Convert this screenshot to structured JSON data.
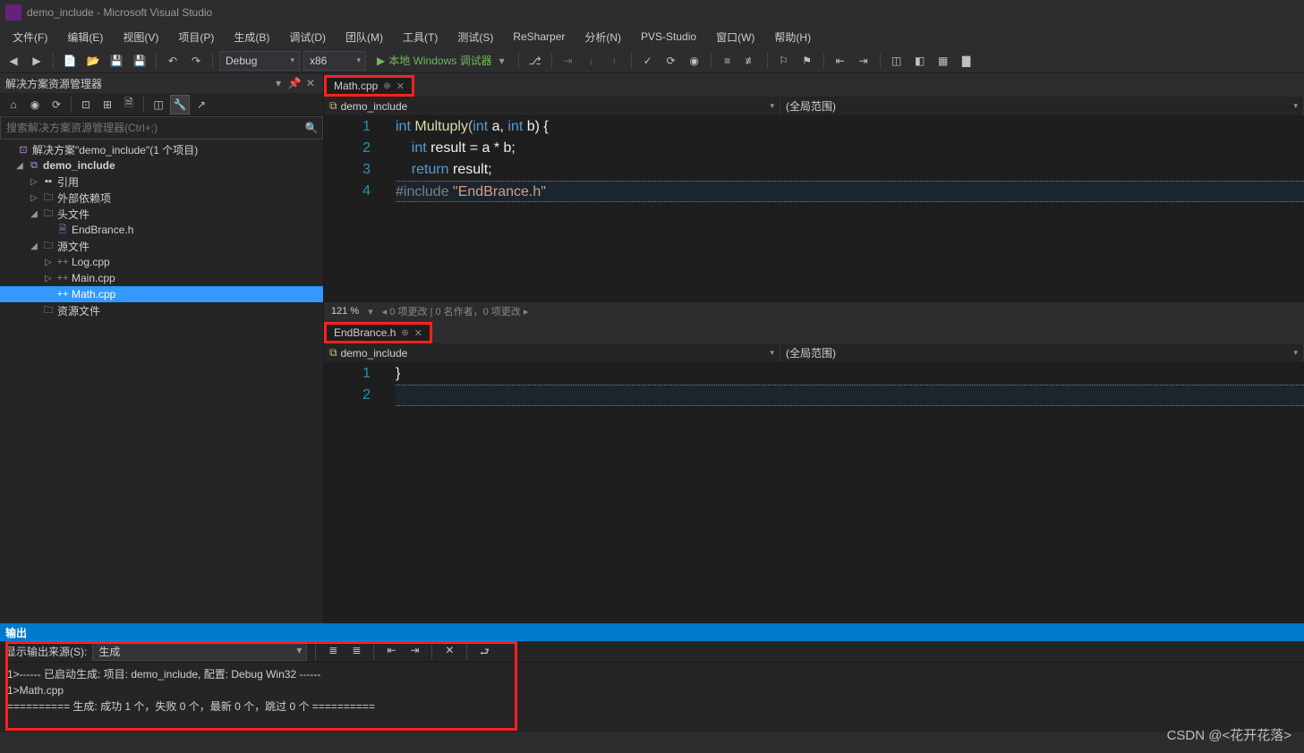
{
  "title": "demo_include - Microsoft Visual Studio",
  "menu": [
    "文件(F)",
    "编辑(E)",
    "视图(V)",
    "项目(P)",
    "生成(B)",
    "调试(D)",
    "团队(M)",
    "工具(T)",
    "测试(S)",
    "ReSharper",
    "分析(N)",
    "PVS-Studio",
    "窗口(W)",
    "帮助(H)"
  ],
  "toolbar": {
    "config": "Debug",
    "platform": "x86",
    "run": "本地 Windows 调试器"
  },
  "explorer": {
    "title": "解决方案资源管理器",
    "search_placeholder": "搜索解决方案资源管理器(Ctrl+;)",
    "solution": "解决方案\"demo_include\"(1 个项目)",
    "project": "demo_include",
    "refs": "引用",
    "ext": "外部依赖项",
    "headers": "头文件",
    "header1": "EndBrance.h",
    "sources": "源文件",
    "src1": "Log.cpp",
    "src2": "Main.cpp",
    "src3": "Math.cpp",
    "resources": "资源文件"
  },
  "editor1": {
    "tab": "Math.cpp",
    "scope_left": "demo_include",
    "scope_right": "(全局范围)",
    "lines": [
      "1",
      "2",
      "3",
      "4"
    ],
    "code": {
      "l1a": "int",
      "l1b": "Multuply",
      "l1c": "(",
      "l1d": "int",
      "l1e": " a, ",
      "l1f": "int",
      "l1g": " b) {",
      "l2a": "int",
      "l2b": " result = a * b;",
      "l3a": "return",
      "l3b": " result;",
      "l4a": "#include ",
      "l4b": "\"EndBrance.h\""
    },
    "zoom": "121 %",
    "status": "0 项更改 | 0 名作者，0 项更改"
  },
  "editor2": {
    "tab": "EndBrance.h",
    "scope_left": "demo_include",
    "scope_right": "(全局范围)",
    "lines": [
      "1",
      "2"
    ],
    "code": {
      "l1": "}"
    }
  },
  "output": {
    "title": "输出",
    "src_label": "显示输出来源(S):",
    "src_value": "生成",
    "line1": "1>------ 已启动生成: 项目: demo_include, 配置: Debug Win32 ------",
    "line2": "1>Math.cpp",
    "line3": "========== 生成: 成功 1 个，失败 0 个，最新 0 个，跳过 0 个 =========="
  },
  "watermark": "CSDN @<花开花落>"
}
